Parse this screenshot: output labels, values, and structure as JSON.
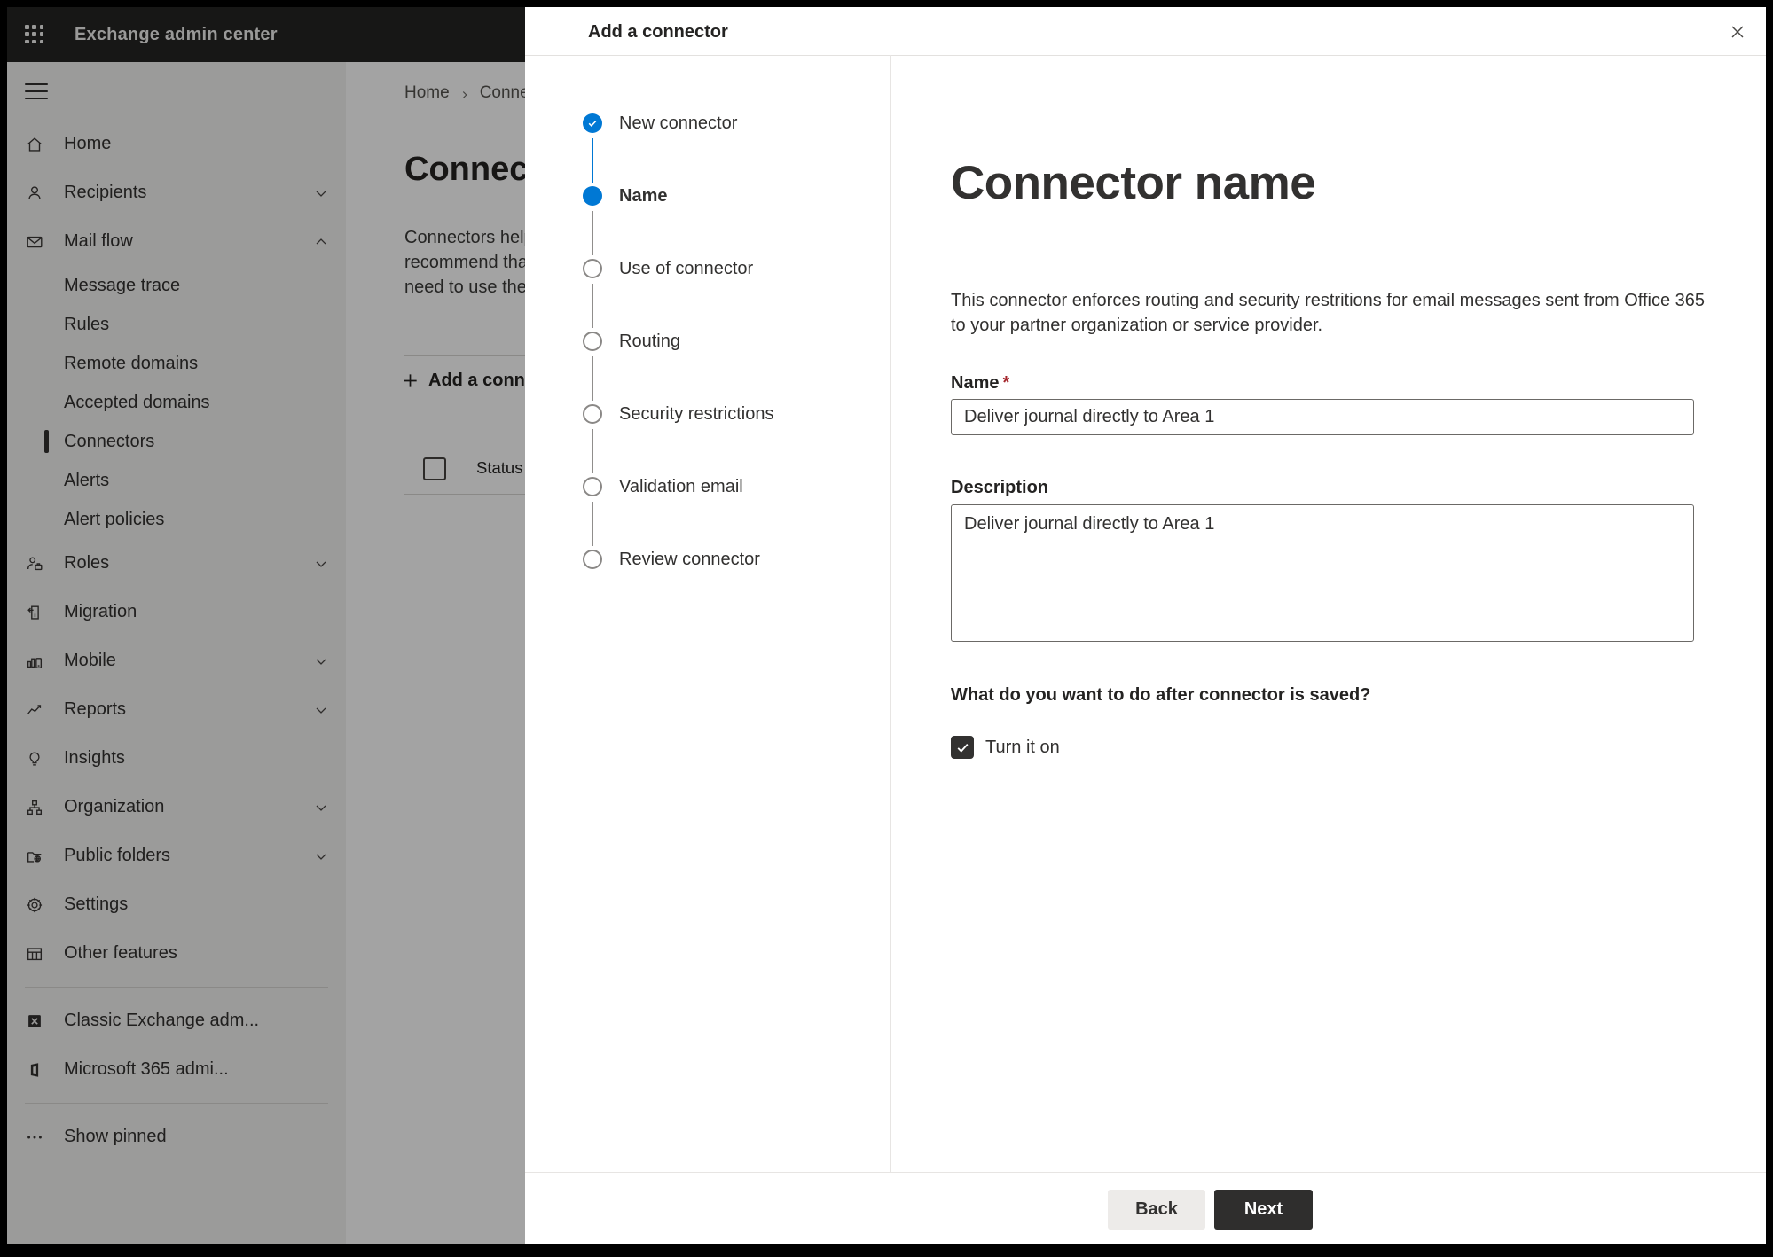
{
  "app": {
    "title": "Exchange admin center"
  },
  "sidebar": {
    "items": [
      {
        "label": "Home"
      },
      {
        "label": "Recipients",
        "has_chevron": true
      },
      {
        "label": "Mail flow",
        "has_chevron": true,
        "expanded": true
      },
      {
        "label": "Message trace"
      },
      {
        "label": "Rules"
      },
      {
        "label": "Remote domains"
      },
      {
        "label": "Accepted domains"
      },
      {
        "label": "Connectors",
        "selected": true
      },
      {
        "label": "Alerts"
      },
      {
        "label": "Alert policies"
      },
      {
        "label": "Roles",
        "has_chevron": true
      },
      {
        "label": "Migration"
      },
      {
        "label": "Mobile",
        "has_chevron": true
      },
      {
        "label": "Reports",
        "has_chevron": true
      },
      {
        "label": "Insights"
      },
      {
        "label": "Organization",
        "has_chevron": true
      },
      {
        "label": "Public folders",
        "has_chevron": true
      },
      {
        "label": "Settings"
      },
      {
        "label": "Other features"
      }
    ],
    "footer_items": [
      {
        "label": "Classic Exchange adm..."
      },
      {
        "label": "Microsoft 365 admi..."
      }
    ],
    "show_pinned": "Show pinned"
  },
  "background_page": {
    "breadcrumb": [
      "Home",
      "Connectors"
    ],
    "title": "Connectors",
    "body_lines": [
      "Connectors help",
      "recommend that",
      "need to use ther"
    ],
    "add_button": "Add a connector",
    "table_header_status": "Status"
  },
  "dialog": {
    "title": "Add a connector",
    "steps": [
      {
        "label": "New connector",
        "state": "completed"
      },
      {
        "label": "Name",
        "state": "current"
      },
      {
        "label": "Use of connector",
        "state": "upcoming"
      },
      {
        "label": "Routing",
        "state": "upcoming"
      },
      {
        "label": "Security restrictions",
        "state": "upcoming"
      },
      {
        "label": "Validation email",
        "state": "upcoming"
      },
      {
        "label": "Review connector",
        "state": "upcoming"
      }
    ],
    "heading": "Connector name",
    "description_lines": [
      "This connector enforces routing and security restritions for email messages sent from Office 365",
      "to your partner organization or service provider."
    ],
    "name_label": "Name",
    "required_marker": "*",
    "name_value": "Deliver journal directly to Area 1",
    "description_label": "Description",
    "description_value": "Deliver journal directly to Area 1",
    "question": "What do you want to do after connector is saved?",
    "checkbox_label": "Turn it on",
    "checkbox_checked": true,
    "back_label": "Back",
    "next_label": "Next"
  },
  "colors": {
    "accent": "#0078d4",
    "required_asterisk": "#a4262c",
    "next_button_bg": "#2f2e2d",
    "next_button_text": "#ffffff",
    "back_button_bg": "#edebe9",
    "checkbox_bg": "#323130",
    "pending_step": "#8a8886",
    "topbar_bg": "#252423"
  }
}
